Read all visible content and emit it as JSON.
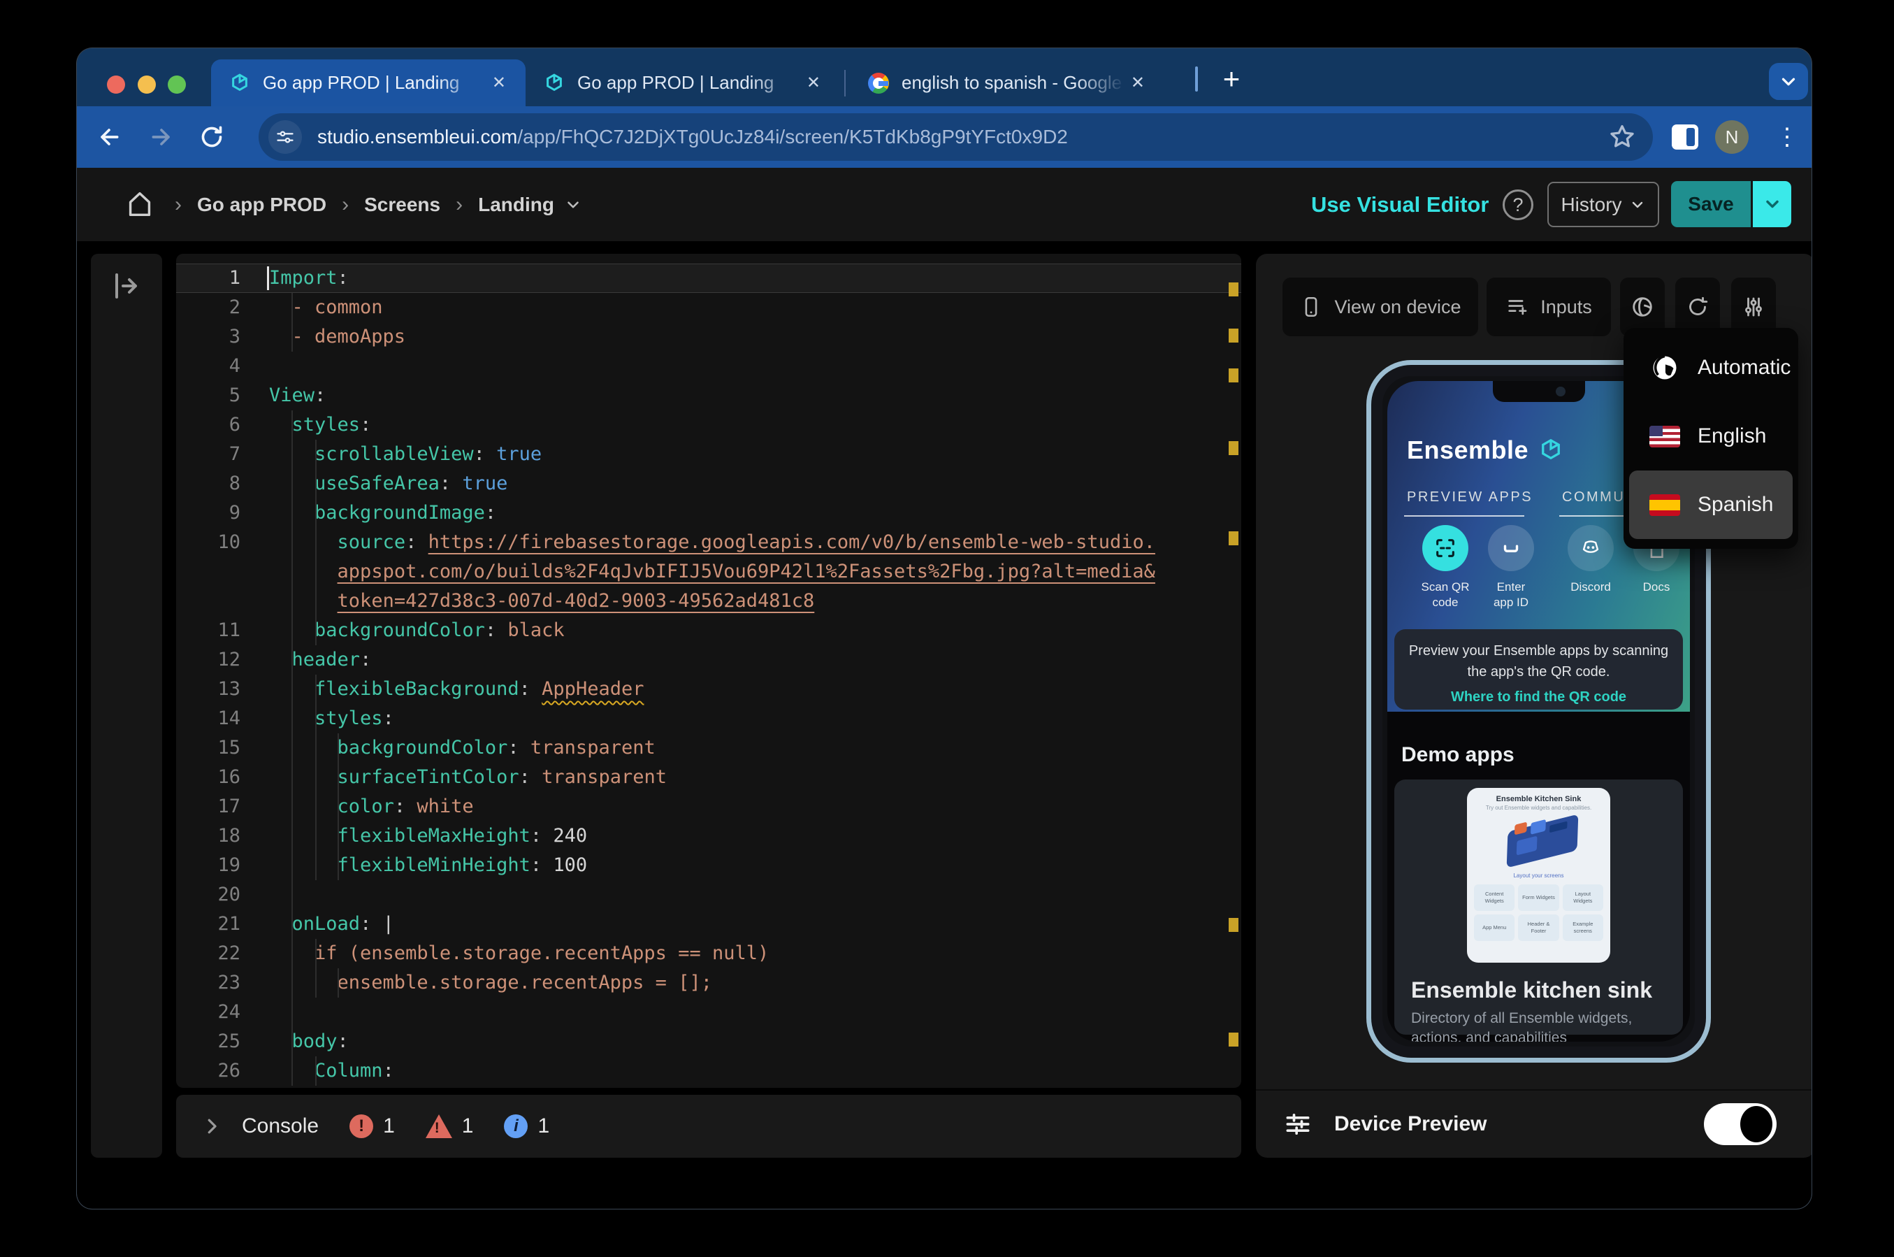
{
  "browser": {
    "tabs": [
      {
        "title": "Go app PROD | Landing",
        "favicon": "ensemble"
      },
      {
        "title": "Go app PROD | Landing",
        "favicon": "ensemble"
      },
      {
        "title": "english to spanish - Google S",
        "favicon": "google"
      }
    ],
    "new_tab_label": "+",
    "url": {
      "domain": "studio.ensembleui.com",
      "path": "/app/FhQC7J2DjXTg0UcJz84i/screen/K5TdKb8gP9tYFct0x9D2"
    },
    "avatar_initial": "N"
  },
  "app_header": {
    "breadcrumb": [
      "Go app PROD",
      "Screens",
      "Landing"
    ],
    "use_visual_editor": "Use Visual Editor",
    "help": "?",
    "history": "History",
    "save": "Save"
  },
  "editor": {
    "rows": [
      {
        "num": "1",
        "active": true,
        "segs": [
          [
            "k",
            "Import"
          ],
          [
            "p",
            ":"
          ]
        ]
      },
      {
        "num": "2",
        "segs": [
          [
            "s",
            "  - common"
          ]
        ]
      },
      {
        "num": "3",
        "segs": [
          [
            "s",
            "  - demoApps"
          ]
        ]
      },
      {
        "num": "4",
        "segs": []
      },
      {
        "num": "5",
        "segs": [
          [
            "k",
            "View"
          ],
          [
            "p",
            ":"
          ]
        ]
      },
      {
        "num": "6",
        "segs": [
          [
            "w",
            "  "
          ],
          [
            "k",
            "styles"
          ],
          [
            "p",
            ":"
          ]
        ]
      },
      {
        "num": "7",
        "segs": [
          [
            "w",
            "    "
          ],
          [
            "k",
            "scrollableView"
          ],
          [
            "p",
            ":"
          ],
          [
            "w",
            " "
          ],
          [
            "b",
            "true"
          ]
        ]
      },
      {
        "num": "8",
        "segs": [
          [
            "w",
            "    "
          ],
          [
            "k",
            "useSafeArea"
          ],
          [
            "p",
            ":"
          ],
          [
            "w",
            " "
          ],
          [
            "b",
            "true"
          ]
        ]
      },
      {
        "num": "9",
        "segs": [
          [
            "w",
            "    "
          ],
          [
            "k",
            "backgroundImage"
          ],
          [
            "p",
            ":"
          ]
        ]
      },
      {
        "num": "10",
        "segs": [
          [
            "w",
            "      "
          ],
          [
            "k",
            "source"
          ],
          [
            "p",
            ":"
          ],
          [
            "w",
            " "
          ],
          [
            "u",
            "https://firebasestorage.googleapis.com/v0/b/ensemble-web-studio."
          ]
        ]
      },
      {
        "num": "",
        "segs": [
          [
            "w",
            "      "
          ],
          [
            "u",
            "appspot.com/o/builds%2F4qJvbIFIJ5Vou69P42l1%2Fassets%2Fbg.jpg?alt=media&"
          ]
        ]
      },
      {
        "num": "",
        "segs": [
          [
            "w",
            "      "
          ],
          [
            "u",
            "token=427d38c3-007d-40d2-9003-49562ad481c8"
          ]
        ]
      },
      {
        "num": "11",
        "segs": [
          [
            "w",
            "    "
          ],
          [
            "k",
            "backgroundColor"
          ],
          [
            "p",
            ":"
          ],
          [
            "s",
            " black"
          ]
        ]
      },
      {
        "num": "12",
        "segs": [
          [
            "w",
            "  "
          ],
          [
            "k",
            "header"
          ],
          [
            "p",
            ":"
          ]
        ]
      },
      {
        "num": "13",
        "segs": [
          [
            "w",
            "    "
          ],
          [
            "k",
            "flexibleBackground"
          ],
          [
            "p",
            ":"
          ],
          [
            "w",
            " "
          ],
          [
            "uw",
            "AppHeader"
          ]
        ]
      },
      {
        "num": "14",
        "segs": [
          [
            "w",
            "    "
          ],
          [
            "k",
            "styles"
          ],
          [
            "p",
            ":"
          ]
        ]
      },
      {
        "num": "15",
        "segs": [
          [
            "w",
            "      "
          ],
          [
            "k",
            "backgroundColor"
          ],
          [
            "p",
            ":"
          ],
          [
            "s",
            " transparent"
          ]
        ]
      },
      {
        "num": "16",
        "segs": [
          [
            "w",
            "      "
          ],
          [
            "k",
            "surfaceTintColor"
          ],
          [
            "p",
            ":"
          ],
          [
            "s",
            " transparent"
          ]
        ]
      },
      {
        "num": "17",
        "segs": [
          [
            "w",
            "      "
          ],
          [
            "k",
            "color"
          ],
          [
            "p",
            ":"
          ],
          [
            "s",
            " white"
          ]
        ]
      },
      {
        "num": "18",
        "segs": [
          [
            "w",
            "      "
          ],
          [
            "k",
            "flexibleMaxHeight"
          ],
          [
            "p",
            ":"
          ],
          [
            "n",
            " 240"
          ]
        ]
      },
      {
        "num": "19",
        "segs": [
          [
            "w",
            "      "
          ],
          [
            "k",
            "flexibleMinHeight"
          ],
          [
            "p",
            ":"
          ],
          [
            "n",
            " 100"
          ]
        ]
      },
      {
        "num": "20",
        "segs": []
      },
      {
        "num": "21",
        "segs": [
          [
            "w",
            "  "
          ],
          [
            "k",
            "onLoad"
          ],
          [
            "p",
            ":"
          ],
          [
            "w",
            " |"
          ]
        ]
      },
      {
        "num": "22",
        "segs": [
          [
            "s",
            "    if (ensemble.storage.recentApps == null)"
          ]
        ]
      },
      {
        "num": "23",
        "segs": [
          [
            "s",
            "      ensemble.storage.recentApps = [];"
          ]
        ]
      },
      {
        "num": "24",
        "segs": []
      },
      {
        "num": "25",
        "segs": [
          [
            "w",
            "  "
          ],
          [
            "k",
            "body"
          ],
          [
            "p",
            ":"
          ]
        ]
      },
      {
        "num": "26",
        "segs": [
          [
            "w",
            "    "
          ],
          [
            "k",
            "Column"
          ],
          [
            "p",
            ":"
          ]
        ]
      }
    ]
  },
  "console": {
    "label": "Console",
    "error_count": "1",
    "warning_count": "1",
    "info_count": "1"
  },
  "preview": {
    "toolbar": {
      "view_on_device": "View on device",
      "inputs": "Inputs"
    },
    "language_menu": [
      {
        "label": "Automatic",
        "icon": "globe",
        "selected": false
      },
      {
        "label": "English",
        "icon": "flag-us",
        "selected": false
      },
      {
        "label": "Spanish",
        "icon": "flag-es",
        "selected": true
      }
    ],
    "device_preview": "Device Preview",
    "phone": {
      "brand": "Ensemble",
      "nav_tabs": [
        "PREVIEW APPS",
        "COMMUNITY &"
      ],
      "actions": [
        {
          "label": "Scan QR\ncode",
          "icon": "qr-scan"
        },
        {
          "label": "Enter\napp ID",
          "icon": "app-id"
        },
        {
          "label": "Discord",
          "icon": "discord"
        },
        {
          "label": "Docs",
          "icon": "docs"
        }
      ],
      "qr_card": {
        "text": "Preview your Ensemble apps by scanning\nthe app's the QR code.",
        "link": "Where to find the QR code"
      },
      "section_title": "Demo apps",
      "demo_card": {
        "mock": {
          "title": "Ensemble Kitchen Sink",
          "subtitle": "Try out Ensemble widgets and capabilities.",
          "caption": "Layout your screens",
          "buttons": [
            "Content\nWidgets",
            "Form Widgets",
            "Layout\nWidgets",
            "App Menu",
            "Header &\nFooter",
            "Example\nscreens"
          ]
        },
        "title": "Ensemble kitchen sink",
        "description": "Directory of all Ensemble widgets, actions, and capabilities"
      }
    }
  },
  "colors": {
    "accent_cyan": "#35E1E1",
    "save_teal": "#1F8F8F",
    "save_caret_cyan": "#3AE9E9",
    "tab_active_blue": "#1B54A2",
    "warning_yellow": "#C9A227",
    "error_red": "#DD6A5E",
    "info_blue": "#63A0F5"
  }
}
